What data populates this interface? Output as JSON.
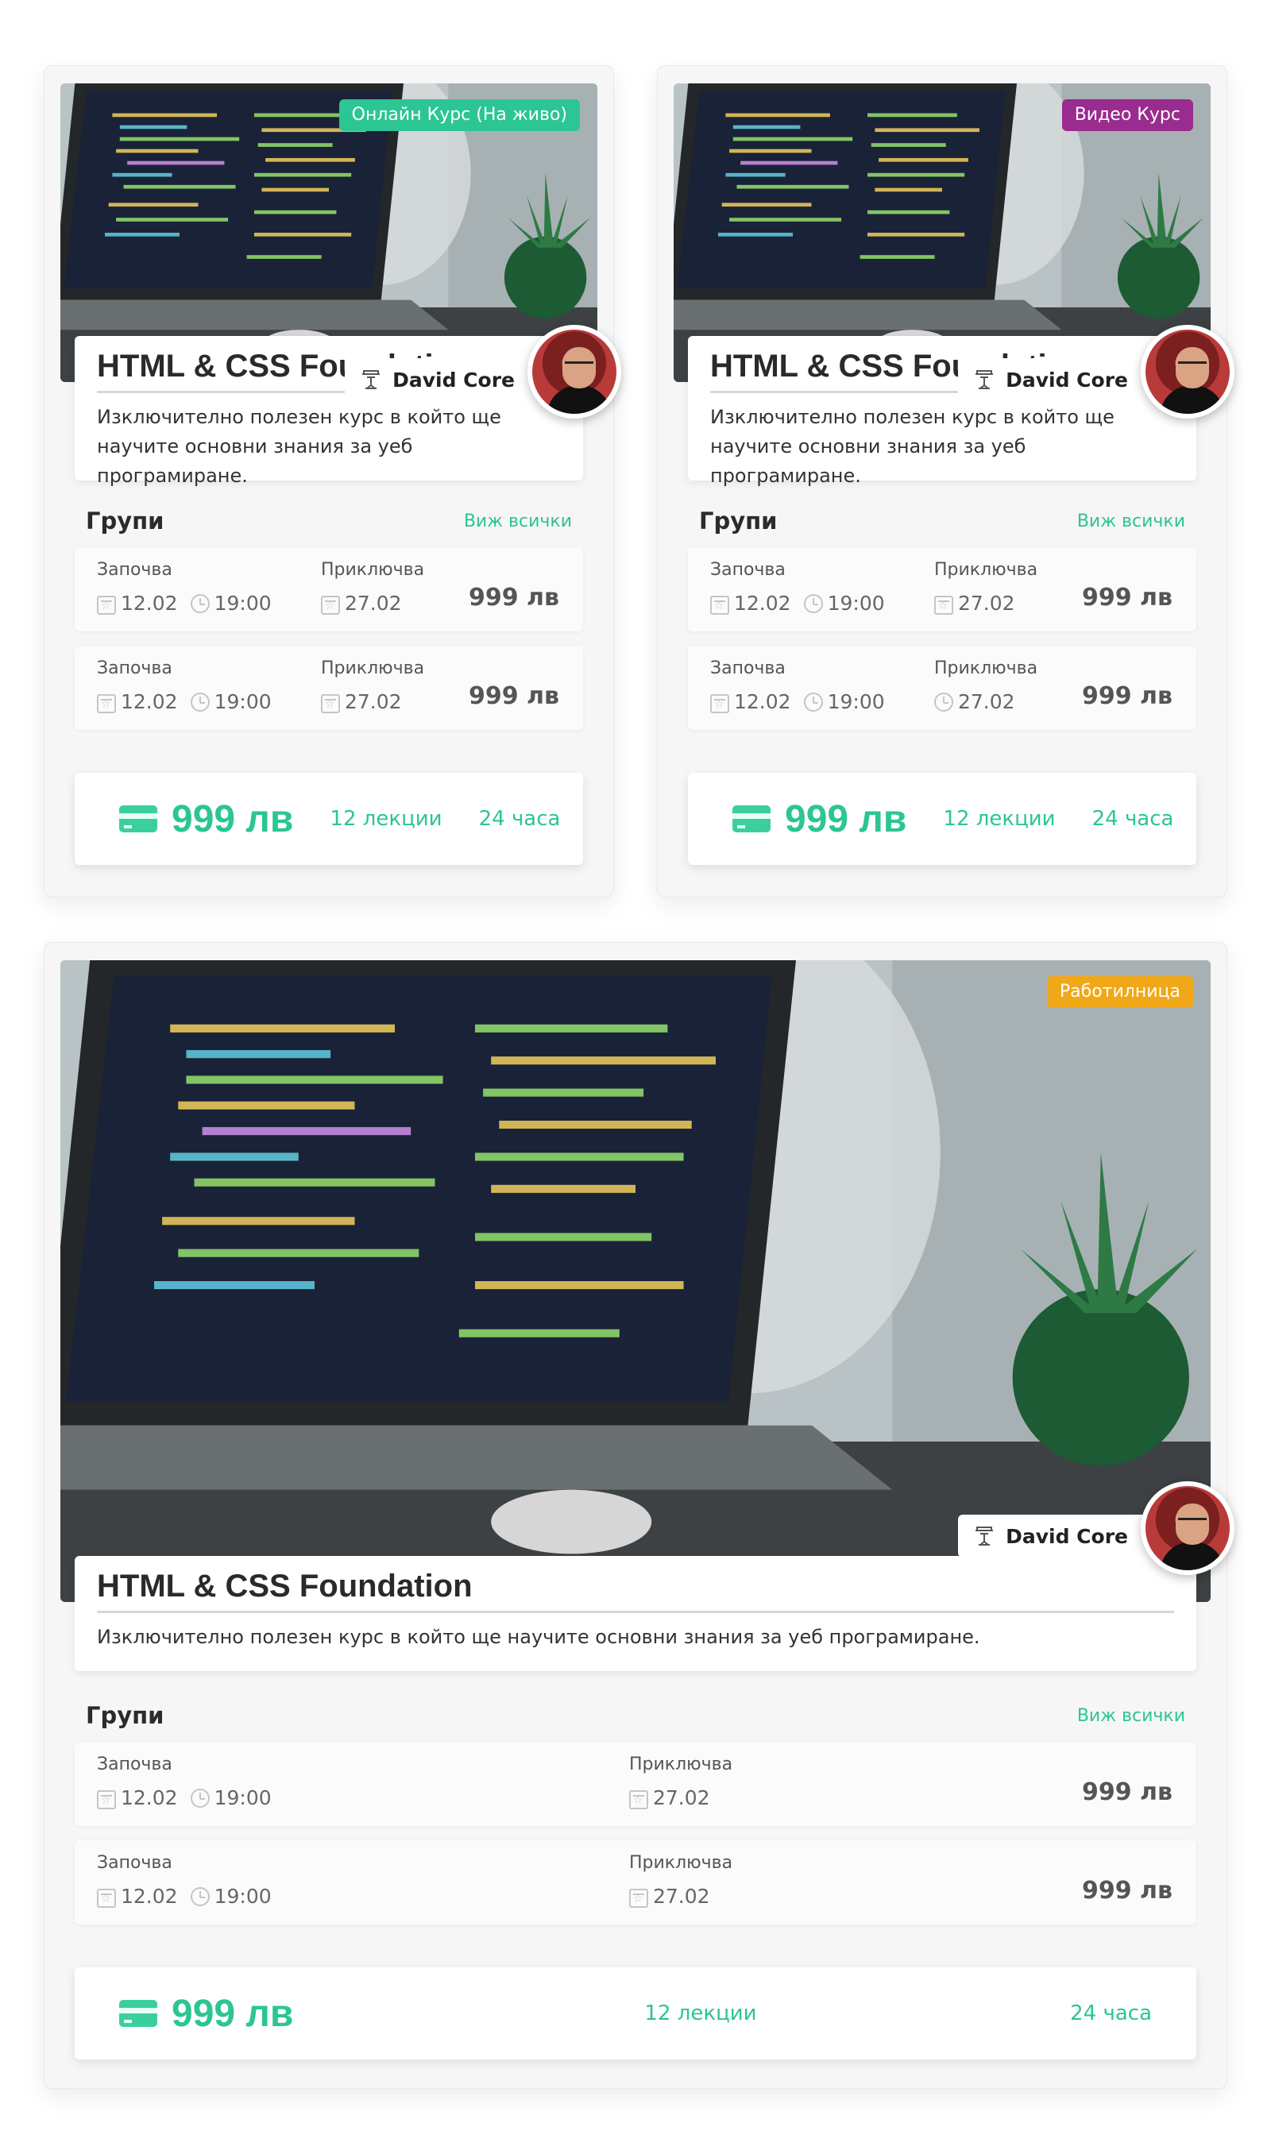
{
  "colors": {
    "accent": "#2cc594",
    "badge_online": "#2cc594",
    "badge_video": "#9a2b8f",
    "badge_workshop": "#f0a818"
  },
  "cards": [
    {
      "badge": "Онлайн Курс (На живо)",
      "author": "David Core",
      "title": "HTML & CSS Foundation",
      "description": "Изключително полезен курс в който ще научите основни знания за уеб програмиране.",
      "groups_title": "Групи",
      "see_all": "Виж всички",
      "groups": [
        {
          "start_label": "Започва",
          "start_date": "12.02",
          "start_time": "19:00",
          "end_label": "Приключва",
          "end_date": "27.02",
          "price": "999 лв"
        },
        {
          "start_label": "Започва",
          "start_date": "12.02",
          "start_time": "19:00",
          "end_label": "Приключва",
          "end_date": "27.02",
          "price": "999 лв"
        }
      ],
      "footer": {
        "price": "999 лв",
        "lectures": "12 лекции",
        "hours": "24 часа"
      }
    },
    {
      "badge": "Видео Курс",
      "author": "David Core",
      "title": "HTML & CSS Foundation",
      "description": "Изключително полезен курс в който ще научите основни знания за уеб програмиране.",
      "groups_title": "Групи",
      "see_all": "Виж всички",
      "groups": [
        {
          "start_label": "Започва",
          "start_date": "12.02",
          "start_time": "19:00",
          "end_label": "Приключва",
          "end_date": "27.02",
          "price": "999 лв"
        },
        {
          "start_label": "Започва",
          "start_date": "12.02",
          "start_time": "19:00",
          "end_label": "Приключва",
          "end_date": "27.02",
          "price": "999 лв"
        }
      ],
      "footer": {
        "price": "999 лв",
        "lectures": "12 лекции",
        "hours": "24 часа"
      }
    },
    {
      "badge": "Работилница",
      "author": "David Core",
      "title": "HTML & CSS Foundation",
      "description": "Изключително полезен курс в който ще научите основни знания за уеб програмиране.",
      "groups_title": "Групи",
      "see_all": "Виж всички",
      "groups": [
        {
          "start_label": "Започва",
          "start_date": "12.02",
          "start_time": "19:00",
          "end_label": "Приключва",
          "end_date": "27.02",
          "price": "999 лв"
        },
        {
          "start_label": "Започва",
          "start_date": "12.02",
          "start_time": "19:00",
          "end_label": "Приключва",
          "end_date": "27.02",
          "price": "999 лв"
        }
      ],
      "footer": {
        "price": "999 лв",
        "lectures": "12 лекции",
        "hours": "24 часа"
      }
    }
  ]
}
